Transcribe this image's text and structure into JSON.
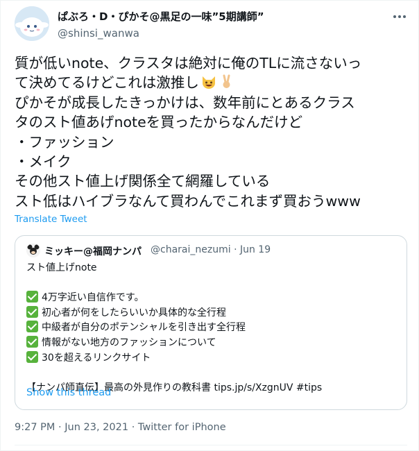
{
  "author": {
    "display_name": "ぱぶろ・D・ぴかそ@黒足の一味”5期講師”",
    "handle": "@shinsi_wanwa",
    "avatar_icon": "cinnamoroll-avatar"
  },
  "tweet": {
    "lines": [
      "質が低いnote、クラスタは絶対に俺のTLに流さないっ",
      "て決めてるけどこれは激推し",
      "ぴかそが成長したきっかけは、数年前にとあるクラス",
      "タのスト値あげnoteを買ったからなんだけど",
      "・ファッション",
      "・メイク",
      "その他スト値上げ関係全て網羅している",
      "スト低はハイブラなんて買わんでこれまず買おうwww"
    ],
    "emojis": [
      "smiling-cat-emoji",
      "victory-hand-emoji"
    ],
    "translate_label": "Translate Tweet",
    "timestamp": "9:27 PM · Jun 23, 2021 · Twitter for iPhone"
  },
  "quote": {
    "display_name": "ミッキー@福岡ナンパ",
    "handle": "@charai_nezumi",
    "date": "· Jun 19",
    "title": "スト値上げnote",
    "checklist": [
      "4万字近い自信作です。",
      "初心者が何をしたらいいか具体的な全行程",
      "中級者が自分のポテンシャルを引き出す全行程",
      "情報がない地方のファッションについて",
      "30を超えるリンクサイト"
    ],
    "promo": "【ナンパ師直伝】最高の外見作りの教科書 tips.jp/s/XzgnUV #tips",
    "show_thread_label": "Show this thread"
  },
  "colors": {
    "link": "#1d9bf0",
    "secondary_text": "#536471",
    "check_green": "#57b23c",
    "border": "#cfd9de"
  }
}
